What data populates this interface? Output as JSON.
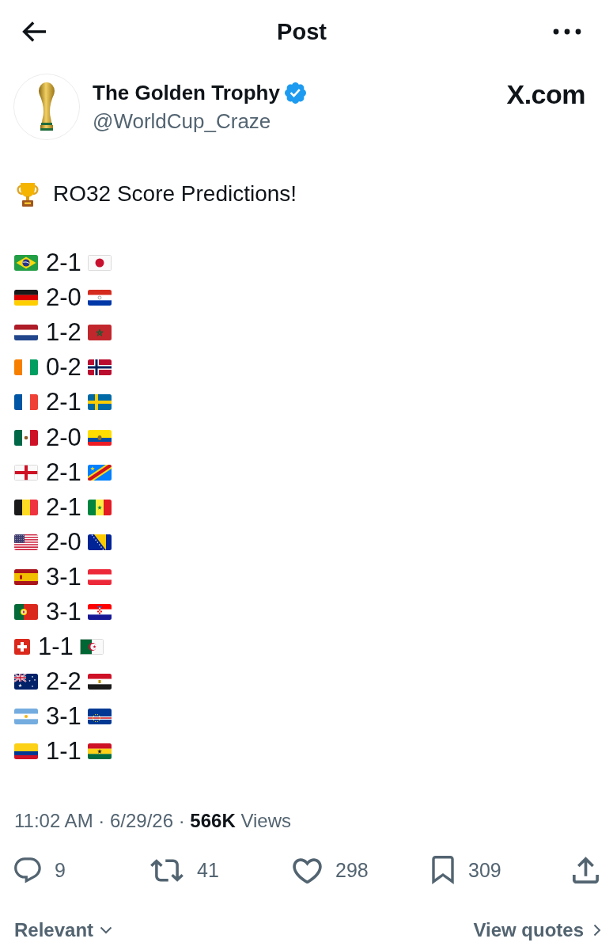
{
  "header": {
    "title": "Post"
  },
  "author": {
    "name": "The Golden Trophy",
    "verified": true,
    "handle": "@WorldCup_Craze"
  },
  "site_label": "X.com",
  "post": {
    "title": "RO32 Score Predictions!",
    "matches": [
      {
        "home": {
          "kind": "brazil"
        },
        "score": "2-1",
        "away": {
          "kind": "japan"
        }
      },
      {
        "home": {
          "kind": "germany"
        },
        "score": "2-0",
        "away": {
          "kind": "paraguay"
        }
      },
      {
        "home": {
          "kind": "netherlands"
        },
        "score": "1-2",
        "away": {
          "kind": "morocco"
        }
      },
      {
        "home": {
          "kind": "ivorycoast"
        },
        "score": "0-2",
        "away": {
          "kind": "norway"
        }
      },
      {
        "home": {
          "kind": "france"
        },
        "score": "2-1",
        "away": {
          "kind": "sweden"
        }
      },
      {
        "home": {
          "kind": "mexico"
        },
        "score": "2-0",
        "away": {
          "kind": "ecuador"
        }
      },
      {
        "home": {
          "kind": "england"
        },
        "score": "2-1",
        "away": {
          "kind": "drcongo"
        }
      },
      {
        "home": {
          "kind": "belgium"
        },
        "score": "2-1",
        "away": {
          "kind": "senegal"
        }
      },
      {
        "home": {
          "kind": "usa"
        },
        "score": "2-0",
        "away": {
          "kind": "bosnia"
        }
      },
      {
        "home": {
          "kind": "spain"
        },
        "score": "3-1",
        "away": {
          "kind": "austria"
        }
      },
      {
        "home": {
          "kind": "portugal"
        },
        "score": "3-1",
        "away": {
          "kind": "croatia"
        }
      },
      {
        "home": {
          "kind": "switzerland"
        },
        "score": "1-1",
        "away": {
          "kind": "algeria"
        }
      },
      {
        "home": {
          "kind": "australia"
        },
        "score": "2-2",
        "away": {
          "kind": "egypt"
        }
      },
      {
        "home": {
          "kind": "argentina"
        },
        "score": "3-1",
        "away": {
          "kind": "capeverde"
        }
      },
      {
        "home": {
          "kind": "colombia"
        },
        "score": "1-1",
        "away": {
          "kind": "ghana"
        }
      }
    ],
    "meta": "11:02 AM · 6/29/26 · **566K** Views"
  },
  "actions": [
    {
      "kind": "reply",
      "count": "9"
    },
    {
      "kind": "repost",
      "count": "41"
    },
    {
      "kind": "like",
      "count": "298"
    },
    {
      "kind": "bookmark",
      "count": "309"
    },
    {
      "kind": "share"
    }
  ],
  "footer": {
    "sort": "Relevant",
    "link": "View quotes"
  }
}
